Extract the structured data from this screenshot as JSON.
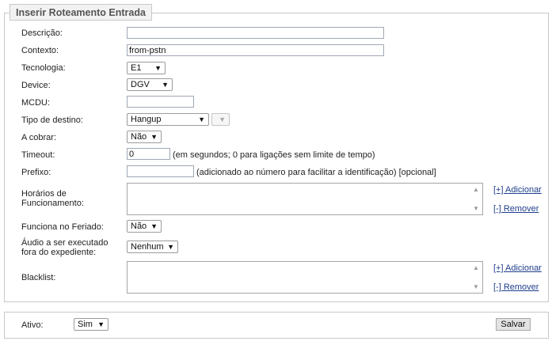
{
  "form": {
    "title": "Inserir Roteamento Entrada",
    "descricao": {
      "label": "Descrição:",
      "value": ""
    },
    "contexto": {
      "label": "Contexto:",
      "value": "from-pstn"
    },
    "tecnologia": {
      "label": "Tecnologia:",
      "value": "E1"
    },
    "device": {
      "label": "Device:",
      "value": "DGV"
    },
    "mcdu": {
      "label": "MCDU:",
      "value": ""
    },
    "tipo_destino": {
      "label": "Tipo de destino:",
      "value": "Hangup",
      "secondary_value": ""
    },
    "a_cobrar": {
      "label": "A cobrar:",
      "value": "Não"
    },
    "timeout": {
      "label": "Timeout:",
      "value": "0",
      "hint": "(em segundos; 0 para ligações sem limite de tempo)"
    },
    "prefixo": {
      "label": "Prefixo:",
      "value": "",
      "hint": "(adicionado ao número para facilitar a identificação) [opcional]"
    },
    "horarios": {
      "label_line1": "Horários de",
      "label_line2": "Funcionamento:",
      "add_link": "[+] Adicionar",
      "remove_link": "[-] Remover"
    },
    "feriado": {
      "label": "Funciona no Feriado:",
      "value": "Não"
    },
    "audio": {
      "label_line1": "Áudio a ser executado",
      "label_line2": "fora do expediente:",
      "value": "Nenhum"
    },
    "blacklist": {
      "label": "Blacklist:",
      "add_link": "[+] Adicionar",
      "remove_link": "[-] Remover"
    }
  },
  "footer": {
    "ativo_label": "Ativo:",
    "ativo_value": "Sim",
    "save_label": "Salvar"
  },
  "icons": {
    "dropdown": "▼",
    "scroll_up": "▲",
    "scroll_down": "▼"
  }
}
